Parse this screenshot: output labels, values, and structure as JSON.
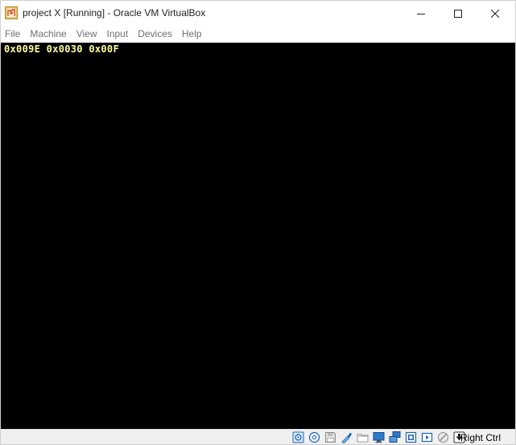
{
  "window": {
    "title": "project X [Running] - Oracle VM VirtualBox"
  },
  "menubar": {
    "items": [
      "File",
      "Machine",
      "View",
      "Input",
      "Devices",
      "Help"
    ]
  },
  "screen": {
    "console_text": "0x009E 0x0030 0x00F"
  },
  "statusbar": {
    "icons": [
      "hard-disk-icon",
      "optical-drive-icon",
      "floppy-drive-icon",
      "audio-icon",
      "shared-folders-icon",
      "display-icon",
      "network-icon",
      "usb-icon",
      "recording-icon",
      "cpu-icon",
      "host-key-arrow-icon"
    ],
    "host_key": "Right Ctrl"
  },
  "colors": {
    "console_background": "#000000",
    "console_text": "#ffff9e",
    "titlebar": "#ffffff",
    "menu_text": "#707070",
    "statusbar": "#f0f0f0",
    "icon_blue": "#1e63b5"
  }
}
